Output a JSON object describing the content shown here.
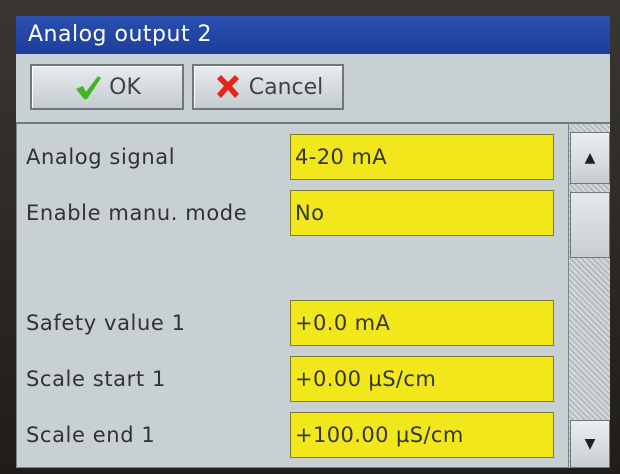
{
  "window": {
    "title": "Analog output 2"
  },
  "toolbar": {
    "ok_label": "OK",
    "cancel_label": "Cancel",
    "ok_icon": "checkmark-icon",
    "cancel_icon": "x-mark-icon",
    "ok_icon_color": "#3fb51f",
    "cancel_icon_color": "#e5261f"
  },
  "fields": [
    {
      "label": "Analog signal",
      "value": "4-20 mA"
    },
    {
      "label": "Enable manu. mode",
      "value": "No"
    },
    {
      "label": "Safety value 1",
      "value": "+0.0 mA"
    },
    {
      "label": "Scale start 1",
      "value": "+0.00 µS/cm"
    },
    {
      "label": "Scale end 1",
      "value": "+100.00 µS/cm"
    }
  ],
  "scrollbar": {
    "up_icon": "arrow-up-icon",
    "down_icon": "arrow-down-icon"
  },
  "colors": {
    "title_bar": "#1d3f9a",
    "field_background": "#f1e71b",
    "panel": "#c9d0d3"
  }
}
